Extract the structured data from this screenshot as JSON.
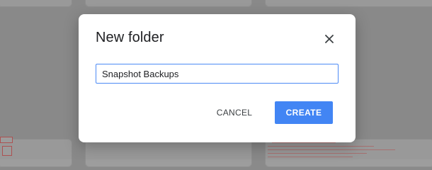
{
  "dialog": {
    "title": "New folder",
    "close_icon": "close-icon",
    "folder_name_value": "Snapshot Backups",
    "cancel_label": "CANCEL",
    "create_label": "CREATE"
  },
  "colors": {
    "accent": "#4285f4",
    "input_border": "#4d8bf5",
    "title_text": "#202124",
    "overlay": "#8a8a8a"
  }
}
